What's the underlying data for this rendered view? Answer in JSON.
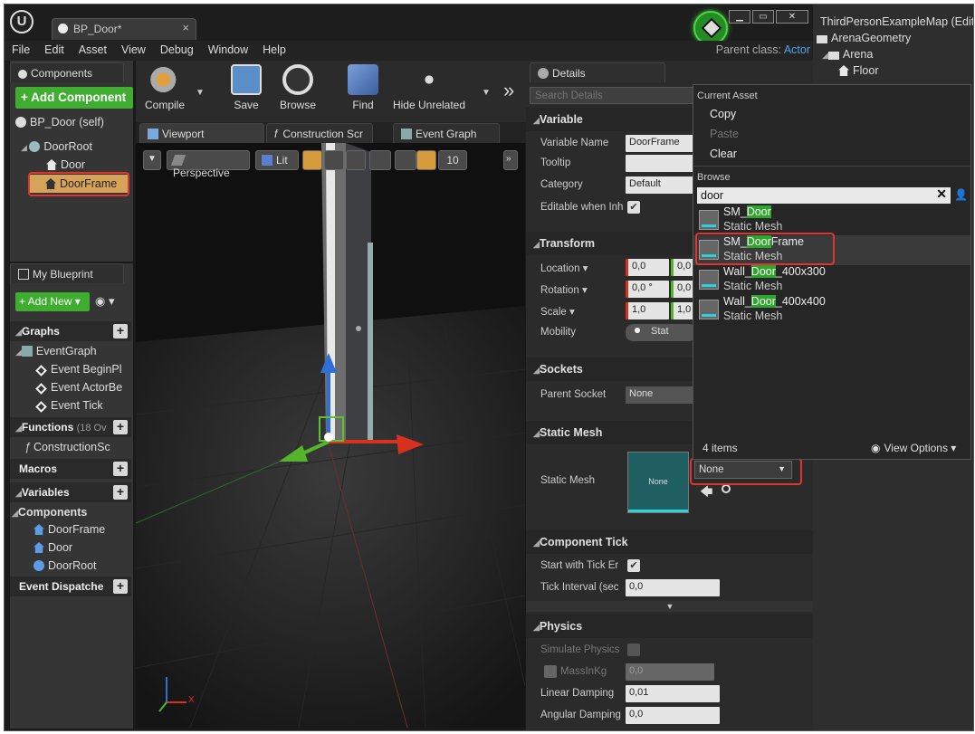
{
  "window": {
    "tab_title": "BP_Door*",
    "tab_close": "×",
    "minimize": "▁",
    "maximize": "▭",
    "close": "✕"
  },
  "menu": {
    "items": [
      "File",
      "Edit",
      "Asset",
      "View",
      "Debug",
      "Window",
      "Help"
    ],
    "parent_class_label": "Parent class:",
    "parent_class_value": "Actor"
  },
  "components": {
    "tab": "Components",
    "add_button": "+ Add Component",
    "items": [
      "BP_Door (self)",
      "DoorRoot",
      "Door",
      "DoorFrame"
    ]
  },
  "my_blueprint": {
    "tab": "My Blueprint",
    "add_new": "+ Add New ▾",
    "sections": {
      "graphs": "Graphs",
      "functions": "Functions",
      "functions_count": "(18 Ov",
      "macros": "Macros",
      "variables": "Variables",
      "components": "Components",
      "event_dispatchers": "Event Dispatche"
    },
    "graphs": [
      "EventGraph",
      "Event BeginPl",
      "Event ActorBe",
      "Event Tick"
    ],
    "functions": [
      "ConstructionSc"
    ],
    "components": [
      "DoorFrame",
      "Door",
      "DoorRoot"
    ]
  },
  "toolbar": {
    "compile": "Compile",
    "save": "Save",
    "browse": "Browse",
    "find": "Find",
    "hide_unrelated": "Hide Unrelated",
    "more": "»"
  },
  "editor_tabs": [
    "Viewport",
    "Construction Scr",
    "Event Graph"
  ],
  "viewport": {
    "perspective": "Perspective",
    "lit": "Lit",
    "grid_snap": "10",
    "axis_x": "X"
  },
  "details": {
    "tab": "Details",
    "search_placeholder": "Search Details",
    "variable_section": "Variable",
    "variable_name_label": "Variable Name",
    "variable_name_value": "DoorFrame",
    "tooltip_label": "Tooltip",
    "category_label": "Category",
    "category_value": "Default",
    "editable_label": "Editable when Inh",
    "transform_section": "Transform",
    "location_label": "Location ▾",
    "location_values": [
      "0,0",
      "0,0"
    ],
    "rotation_label": "Rotation ▾",
    "rotation_values": [
      "0,0 °",
      "0,0"
    ],
    "scale_label": "Scale ▾",
    "scale_values": [
      "1,0",
      "1,0"
    ],
    "mobility_label": "Mobility",
    "mobility_value": "Stat",
    "sockets_section": "Sockets",
    "parent_socket_label": "Parent Socket",
    "parent_socket_value": "None",
    "static_mesh_section": "Static Mesh",
    "static_mesh_label": "Static Mesh",
    "static_mesh_thumb": "None",
    "static_mesh_combo": "None",
    "component_tick_section": "Component Tick",
    "start_tick_label": "Start with Tick Er",
    "tick_interval_label": "Tick Interval (sec",
    "tick_interval_value": "0,0",
    "physics_section": "Physics",
    "simulate_physics_label": "Simulate Physics",
    "mass_label": "MassInKg",
    "mass_value": "0,0",
    "linear_damping_label": "Linear Damping",
    "linear_damping_value": "0,01",
    "angular_damping_label": "Angular Damping",
    "angular_damping_value": "0,0"
  },
  "popup": {
    "current_asset": "Current Asset",
    "copy": "Copy",
    "paste": "Paste",
    "clear": "Clear",
    "browse": "Browse",
    "search_value": "door",
    "assets": [
      {
        "pre": "SM_",
        "match": "Door",
        "post": "",
        "type": "Static Mesh"
      },
      {
        "pre": "SM_",
        "match": "Door",
        "post": "Frame",
        "type": "Static Mesh"
      },
      {
        "pre": "Wall_",
        "match": "Door",
        "post": "_400x300",
        "type": "Static Mesh"
      },
      {
        "pre": "Wall_",
        "match": "Door",
        "post": "_400x400",
        "type": "Static Mesh"
      }
    ],
    "count": "4 items",
    "view_options": "View Options ▾"
  },
  "outliner": {
    "items": [
      "ThirdPersonExampleMap (Editor)",
      "ArenaGeometry",
      "Arena",
      "Floor"
    ]
  },
  "colors": {
    "accent_blue": "#4ea3e6",
    "highlight_green": "#2ea62e",
    "annotation_red": "#e03434"
  }
}
